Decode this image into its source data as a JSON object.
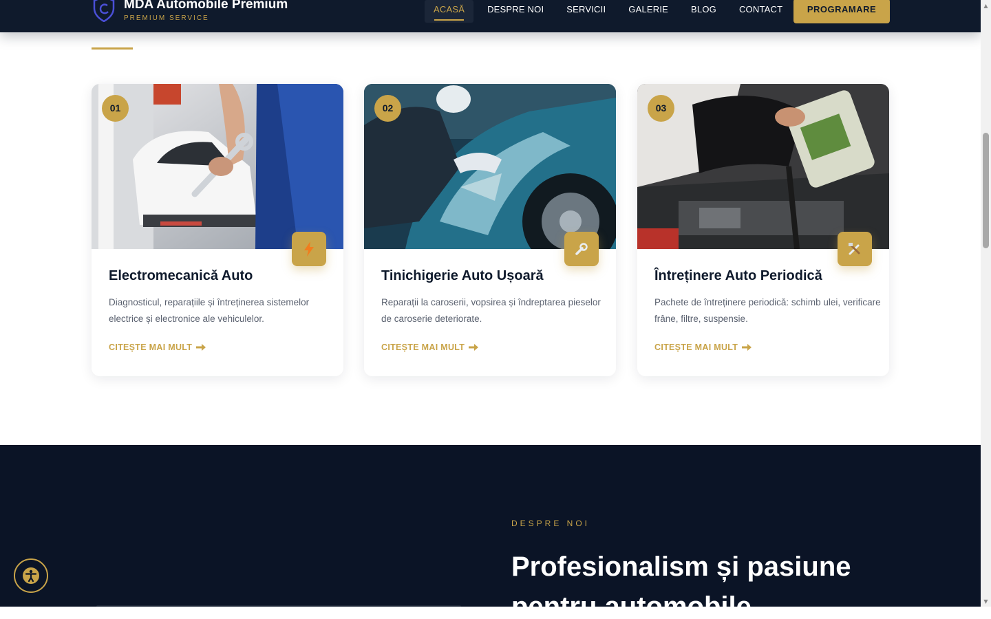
{
  "header": {
    "brand_name": "MDA Automobile Premium",
    "brand_tagline": "PREMIUM SERVICE",
    "nav": [
      {
        "label": "ACASĂ",
        "active": true
      },
      {
        "label": "DESPRE NOI",
        "active": false
      },
      {
        "label": "SERVICII",
        "active": false
      },
      {
        "label": "GALERIE",
        "active": false
      },
      {
        "label": "BLOG",
        "active": false
      },
      {
        "label": "CONTACT",
        "active": false
      }
    ],
    "cta_label": "PROGRAMARE"
  },
  "services": [
    {
      "number": "01",
      "icon": "lightning-icon",
      "title": "Electromecanică Auto",
      "description": "Diagnosticul, reparațiile și întreținerea sistemelor electrice și electronice ale vehiculelor.",
      "link_label": "CITEȘTE MAI MULT"
    },
    {
      "number": "02",
      "icon": "wrench-icon",
      "title": "Tinichigerie Auto Ușoară",
      "description": "Reparații la caroserii, vopsirea și îndreptarea pieselor de caroserie deteriorate.",
      "link_label": "CITEȘTE MAI MULT"
    },
    {
      "number": "03",
      "icon": "tools-icon",
      "title": "Întreținere Auto Periodică",
      "description": "Pachete de întreținere periodică: schimb ulei, verificare frâne, filtre, suspensie.",
      "link_label": "CITEȘTE MAI MULT"
    }
  ],
  "about": {
    "kicker": "DESPRE NOI",
    "title": "Profesionalism și pasiune pentru automobile"
  },
  "colors": {
    "navy": "#0f1a2c",
    "gold": "#c9a449",
    "text_muted": "#5b6270"
  }
}
